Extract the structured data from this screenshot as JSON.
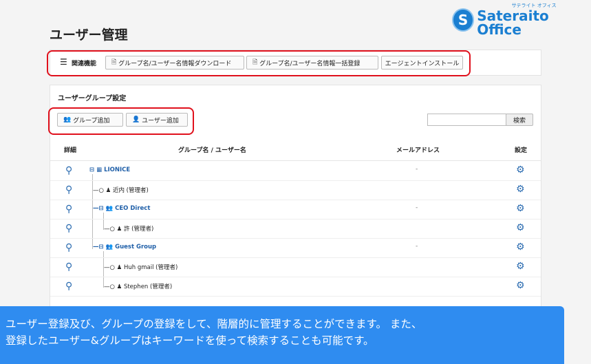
{
  "logo": {
    "name": "Sateraito Office",
    "kana": "サテライト オフィス",
    "seal": "S"
  },
  "title": "ユーザー管理",
  "toolbar": {
    "label": "関連機能",
    "buttons": [
      "グループ名/ユーザー名情報ダウンロード",
      "グループ名/ユーザー名情報一括登録",
      "エージェントインストール"
    ]
  },
  "section": {
    "title": "ユーザーグループ設定",
    "add_group": "グループ追加",
    "add_user": "ユーザー追加",
    "search_button": "検索",
    "search_value": ""
  },
  "table": {
    "headers": [
      "詳細",
      "グループ名 / ユーザー名",
      "メールアドレス",
      "設定"
    ],
    "rows": [
      {
        "name": "LIONICE",
        "type": "org",
        "email": "-"
      },
      {
        "name": "近内 (管理者)",
        "type": "user",
        "email": ""
      },
      {
        "name": "CEO Direct",
        "type": "group",
        "email": "-"
      },
      {
        "name": "許 (管理者)",
        "type": "user",
        "email": ""
      },
      {
        "name": "Guest Group",
        "type": "group",
        "email": "-"
      },
      {
        "name": "Huh gmail (管理者)",
        "type": "user",
        "email": ""
      },
      {
        "name": "Stephen (管理者)",
        "type": "user",
        "email": ""
      }
    ]
  },
  "caption": [
    "ユーザー登録及び、グループの登録をして、階層的に管理することができます。 また、",
    "登録したユーザー&グループはキーワードを使って検索することも可能です。"
  ]
}
